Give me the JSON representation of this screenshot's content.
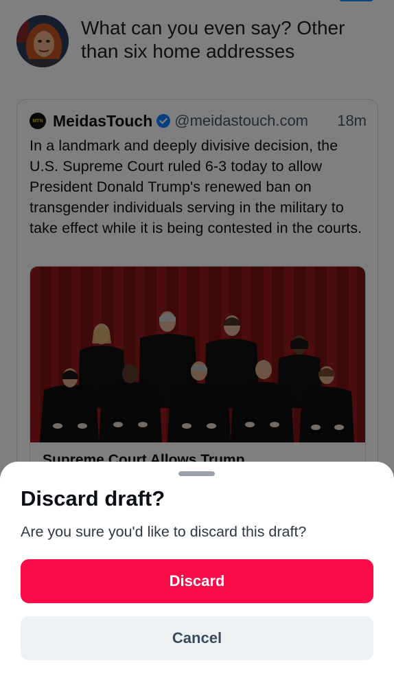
{
  "colors": {
    "scrim": "rgba(0,0,0,0.5)",
    "discard_button_bg": "#f90c47",
    "cancel_button_bg": "#eef1f4",
    "verified_badge": "#1083fe",
    "handle_text": "#42576c"
  },
  "composer": {
    "draft_text": "What can you even say? Other than six home addresses",
    "quote": {
      "avatar_text": "MTN",
      "author_name": "MeidasTouch",
      "verified_icon": "verified-badge-icon",
      "handle": "@meidastouch.com",
      "time": "18m",
      "body": "In a landmark and deeply divisive decision, the U.S. Supreme Court ruled 6-3 today to allow President Donald Trump's renewed ban on transgender individuals serving in the military to take effect while it is being contested in the courts.",
      "link_card": {
        "title": "Supreme Court Allows Trump"
      }
    }
  },
  "sheet": {
    "title": "Discard draft?",
    "message": "Are you sure you'd like to discard this draft?",
    "discard_label": "Discard",
    "cancel_label": "Cancel"
  }
}
